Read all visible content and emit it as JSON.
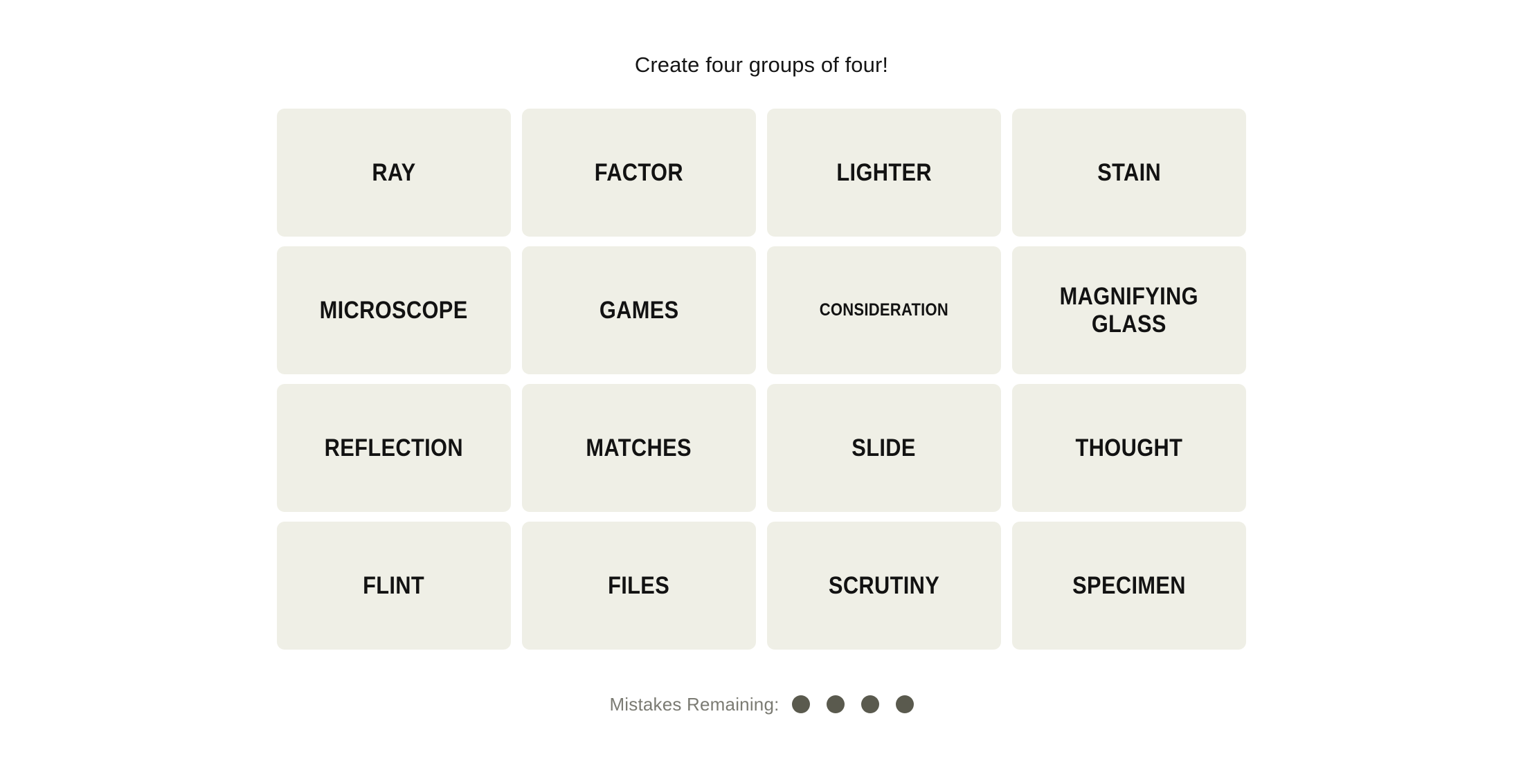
{
  "header": {
    "title": "Create four groups of four!"
  },
  "board": {
    "rows": 4,
    "columns": 4,
    "tiles": [
      {
        "label": "RAY",
        "size": "normal"
      },
      {
        "label": "FACTOR",
        "size": "normal"
      },
      {
        "label": "LIGHTER",
        "size": "normal"
      },
      {
        "label": "STAIN",
        "size": "normal"
      },
      {
        "label": "MICROSCOPE",
        "size": "normal"
      },
      {
        "label": "GAMES",
        "size": "normal"
      },
      {
        "label": "CONSIDERATION",
        "size": "small"
      },
      {
        "label": "MAGNIFYING\nGLASS",
        "size": "two-line"
      },
      {
        "label": "REFLECTION",
        "size": "normal"
      },
      {
        "label": "MATCHES",
        "size": "normal"
      },
      {
        "label": "SLIDE",
        "size": "normal"
      },
      {
        "label": "THOUGHT",
        "size": "normal"
      },
      {
        "label": "FLINT",
        "size": "normal"
      },
      {
        "label": "FILES",
        "size": "normal"
      },
      {
        "label": "SCRUTINY",
        "size": "normal"
      },
      {
        "label": "SPECIMEN",
        "size": "normal"
      }
    ]
  },
  "footer": {
    "mistakes_label": "Mistakes Remaining:",
    "mistakes_remaining": 4,
    "dots": [
      {
        "state": "filled"
      },
      {
        "state": "filled"
      },
      {
        "state": "filled"
      },
      {
        "state": "filled"
      }
    ]
  },
  "colors": {
    "page_background": "#FFFFFF",
    "tile_background": "#EFEFE6",
    "tile_text": "#121212",
    "title_text": "#151515",
    "mistakes_label_text": "#7B7B73",
    "dot_fill": "#5A5A4E"
  }
}
